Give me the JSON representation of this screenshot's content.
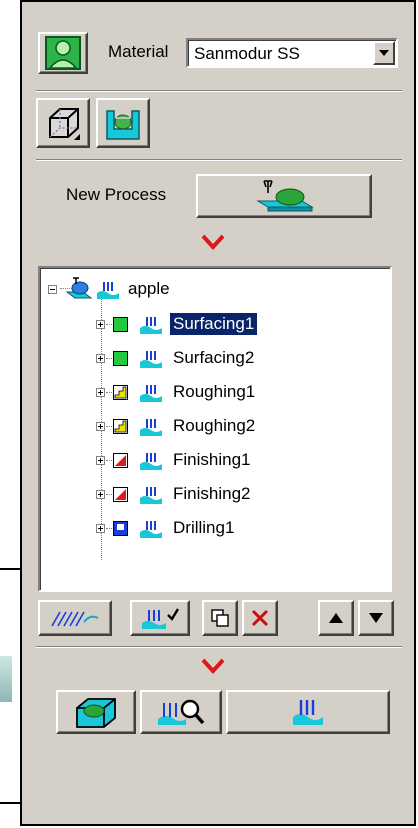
{
  "material": {
    "label": "Material",
    "value": "Sanmodur SS"
  },
  "new_process": {
    "label": "New Process"
  },
  "tree": {
    "root": "apple",
    "children": [
      {
        "label": "Surfacing1",
        "type": "surfacing",
        "selected": true
      },
      {
        "label": "Surfacing2",
        "type": "surfacing",
        "selected": false
      },
      {
        "label": "Roughing1",
        "type": "roughing",
        "selected": false
      },
      {
        "label": "Roughing2",
        "type": "roughing",
        "selected": false
      },
      {
        "label": "Finishing1",
        "type": "finishing",
        "selected": false
      },
      {
        "label": "Finishing2",
        "type": "finishing",
        "selected": false
      },
      {
        "label": "Drilling1",
        "type": "drilling",
        "selected": false
      }
    ]
  },
  "colors": {
    "surfacing": "#22c93a",
    "roughing": "#f0e000",
    "finishing": "#e01818",
    "drilling": "#1a3fd6",
    "arrow": "#e0161a",
    "selection": "#0a246a"
  },
  "icons": {
    "user_button": "user-icon",
    "stock_box": "stock-box-icon",
    "fixture": "fixture-icon",
    "new_process": "machine-icon",
    "toolpath": "toolpath-icon",
    "operation_check": "operation-check-icon",
    "copy": "copy-icon",
    "delete": "delete-icon",
    "move_up": "up-arrow-icon",
    "move_down": "down-arrow-icon",
    "simulate": "simulate-icon",
    "inspect": "inspect-icon",
    "generate": "generate-icon"
  }
}
